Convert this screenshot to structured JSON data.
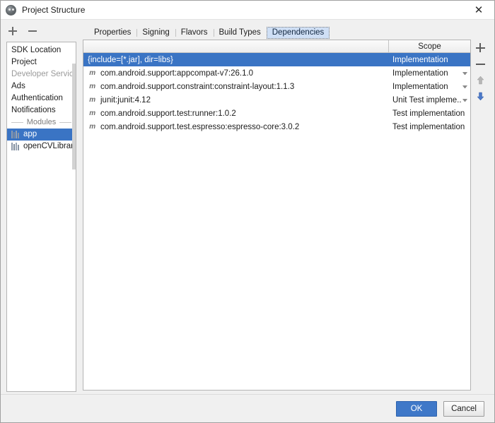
{
  "window": {
    "title": "Project Structure",
    "icon": "android-studio-icon",
    "close_label": "✕"
  },
  "left_toolbar": {
    "add_label": "+",
    "remove_label": "−"
  },
  "sidebar": {
    "items": [
      {
        "label": "SDK Location",
        "type": "item",
        "muted": false,
        "selected": false
      },
      {
        "label": "Project",
        "type": "item",
        "muted": false,
        "selected": false
      },
      {
        "label": "Developer Services",
        "type": "item",
        "muted": true,
        "selected": false
      },
      {
        "label": "Ads",
        "type": "item",
        "muted": false,
        "selected": false
      },
      {
        "label": "Authentication",
        "type": "item",
        "muted": false,
        "selected": false
      },
      {
        "label": "Notifications",
        "type": "item",
        "muted": false,
        "selected": false
      }
    ],
    "separator_label": "Modules",
    "modules": [
      {
        "label": "app",
        "icon": "module-icon",
        "selected": true
      },
      {
        "label": "openCVLibrary...",
        "icon": "module-icon",
        "selected": false
      }
    ]
  },
  "tabs": [
    {
      "label": "Properties",
      "active": false
    },
    {
      "label": "Signing",
      "active": false
    },
    {
      "label": "Flavors",
      "active": false
    },
    {
      "label": "Build Types",
      "active": false
    },
    {
      "label": "Dependencies",
      "active": true
    }
  ],
  "table": {
    "columns": [
      "",
      "Scope"
    ],
    "rows": [
      {
        "name": "{include=[*.jar], dir=libs}",
        "icon": "",
        "scope": "Implementation",
        "has_dropdown": false,
        "selected": true
      },
      {
        "name": "com.android.support:appcompat-v7:26.1.0",
        "icon": "m",
        "scope": "Implementation",
        "has_dropdown": true,
        "selected": false
      },
      {
        "name": "com.android.support.constraint:constraint-layout:1.1.3",
        "icon": "m",
        "scope": "Implementation",
        "has_dropdown": true,
        "selected": false
      },
      {
        "name": "junit:junit:4.12",
        "icon": "m",
        "scope": "Unit Test impleme..",
        "has_dropdown": true,
        "selected": false
      },
      {
        "name": "com.android.support.test:runner:1.0.2",
        "icon": "m",
        "scope": "Test implementation",
        "has_dropdown": false,
        "selected": false
      },
      {
        "name": "com.android.support.test.espresso:espresso-core:3.0.2",
        "icon": "m",
        "scope": "Test implementation",
        "has_dropdown": false,
        "selected": false
      }
    ]
  },
  "table_toolbar": {
    "add_label": "+",
    "remove_label": "−",
    "move_up_label": "move up",
    "move_down_label": "move down"
  },
  "footer": {
    "ok_label": "OK",
    "cancel_label": "Cancel"
  },
  "colors": {
    "selection_blue": "#3a74c4",
    "primary_button": "#3f78c8",
    "active_tab": "#cfdff5",
    "muted_text": "#9a9a9a"
  }
}
